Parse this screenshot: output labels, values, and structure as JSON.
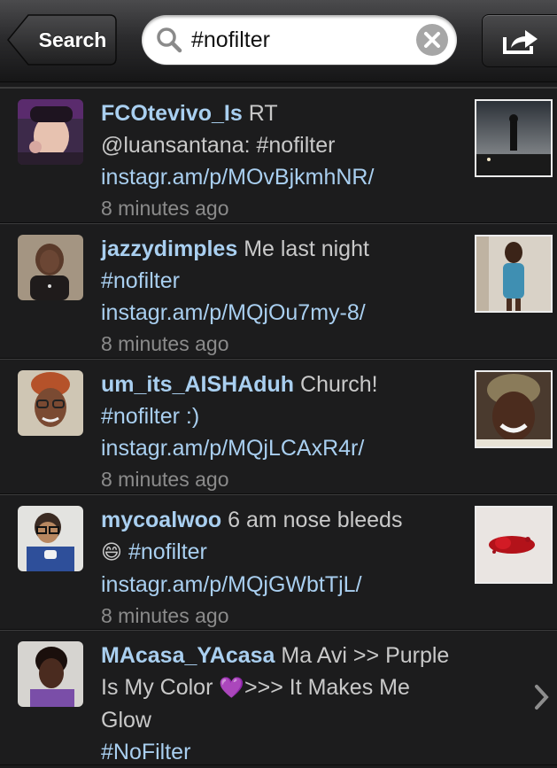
{
  "navbar": {
    "back_label": "Search",
    "search_query": "#nofilter",
    "search_icon": "magnifier-icon",
    "clear_icon": "clear-x-icon",
    "share_icon": "share-icon"
  },
  "tweets": [
    {
      "username": "FCOtevivo_Is",
      "text": "RT",
      "lines": [
        "@luansantana: #nofilter"
      ],
      "link": "instagr.am/p/MOvBjkmhNR/",
      "time": "8 minutes ago"
    },
    {
      "username": "jazzydimples",
      "text": "Me last night",
      "lines": [
        "#nofilter"
      ],
      "link": "instagr.am/p/MQjOu7my-8/",
      "time": "8 minutes ago"
    },
    {
      "username": "um_its_AISHAduh",
      "text": "Church!",
      "lines": [
        "#nofilter :)"
      ],
      "link": "instagr.am/p/MQjLCAxR4r/",
      "time": "8 minutes ago"
    },
    {
      "username": "mycoalwoo",
      "text": "6 am nose bleeds",
      "emoji": "😄",
      "lines": [
        "#nofilter"
      ],
      "link": "instagr.am/p/MQjGWbtTjL/",
      "time": "8 minutes ago"
    },
    {
      "username": "MAcasa_YAcasa",
      "text": "Ma Avi >> Purple",
      "line2a": "Is My Color",
      "emoji": "💜",
      "line2b": ">>> It Makes Me Glow",
      "line3": "#NoFilter"
    }
  ],
  "colors": {
    "username": "#a9cff0",
    "body_text": "#c9c9c9",
    "timestamp": "#8b8b8b",
    "background": "#1c1c1d"
  }
}
